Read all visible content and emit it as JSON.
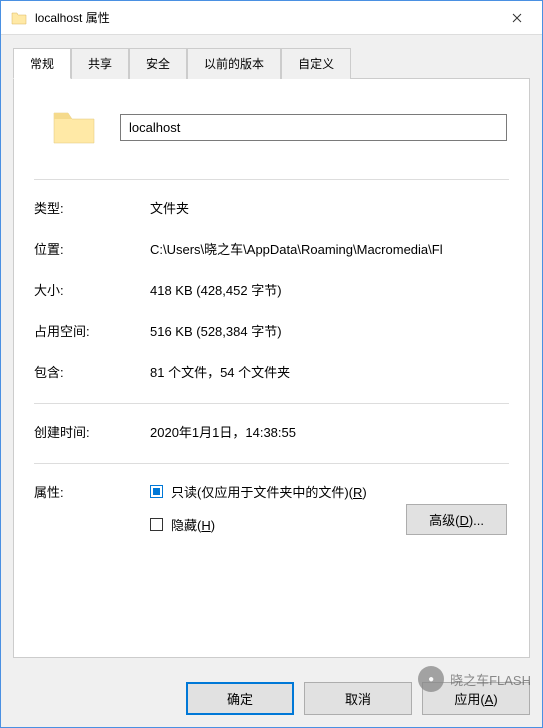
{
  "window": {
    "title": "localhost 属性"
  },
  "tabs": [
    {
      "label": "常规"
    },
    {
      "label": "共享"
    },
    {
      "label": "安全"
    },
    {
      "label": "以前的版本"
    },
    {
      "label": "自定义"
    }
  ],
  "folder": {
    "name": "localhost"
  },
  "properties": {
    "type_label": "类型:",
    "type_value": "文件夹",
    "location_label": "位置:",
    "location_value": "C:\\Users\\晓之车\\AppData\\Roaming\\Macromedia\\Fl",
    "size_label": "大小:",
    "size_value": "418 KB (428,452 字节)",
    "size_on_disk_label": "占用空间:",
    "size_on_disk_value": "516 KB (528,384 字节)",
    "contains_label": "包含:",
    "contains_value": "81 个文件，54 个文件夹",
    "created_label": "创建时间:",
    "created_value": "2020年1月1日，14:38:55"
  },
  "attributes": {
    "label": "属性:",
    "readonly_text": "只读(仅应用于文件夹中的文件)(",
    "readonly_accel": "R",
    "readonly_suffix": ")",
    "hidden_text": "隐藏(",
    "hidden_accel": "H",
    "hidden_suffix": ")",
    "advanced_text": "高级(",
    "advanced_accel": "D",
    "advanced_suffix": ")..."
  },
  "buttons": {
    "ok": "确定",
    "cancel": "取消",
    "apply_text": "应用(",
    "apply_accel": "A",
    "apply_suffix": ")"
  },
  "watermark": {
    "text": "晓之车FLASH"
  }
}
